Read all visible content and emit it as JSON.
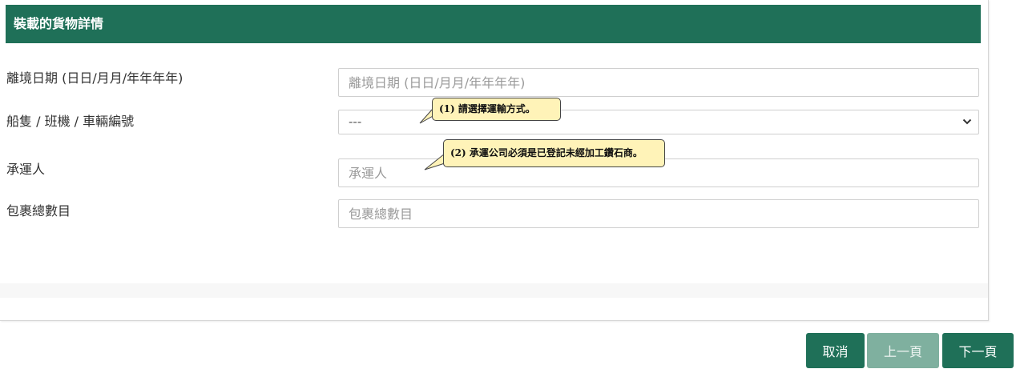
{
  "header": {
    "title": "裝載的貨物詳情"
  },
  "form": {
    "departure_date": {
      "label": "離境日期 (日日/月月/年年年年)",
      "placeholder": "離境日期 (日日/月月/年年年年)"
    },
    "vessel": {
      "label": "船隻 / 班機 / 車輛編號",
      "selected": "---"
    },
    "carrier": {
      "label": "承運人",
      "placeholder": "承運人"
    },
    "packages": {
      "label": "包裹總數目",
      "placeholder": "包裹總數目"
    }
  },
  "callouts": {
    "transport": "(1) 請選擇運輸方式。",
    "carrier": "(2) 承運公司必須是已登記未經加工鑽石商。"
  },
  "buttons": {
    "cancel": "取消",
    "prev": "上一頁",
    "next": "下一頁"
  },
  "colors": {
    "brand": "#1f7058",
    "button_disabled": "#7fb09f",
    "callout_bg": "#fff3b8"
  }
}
